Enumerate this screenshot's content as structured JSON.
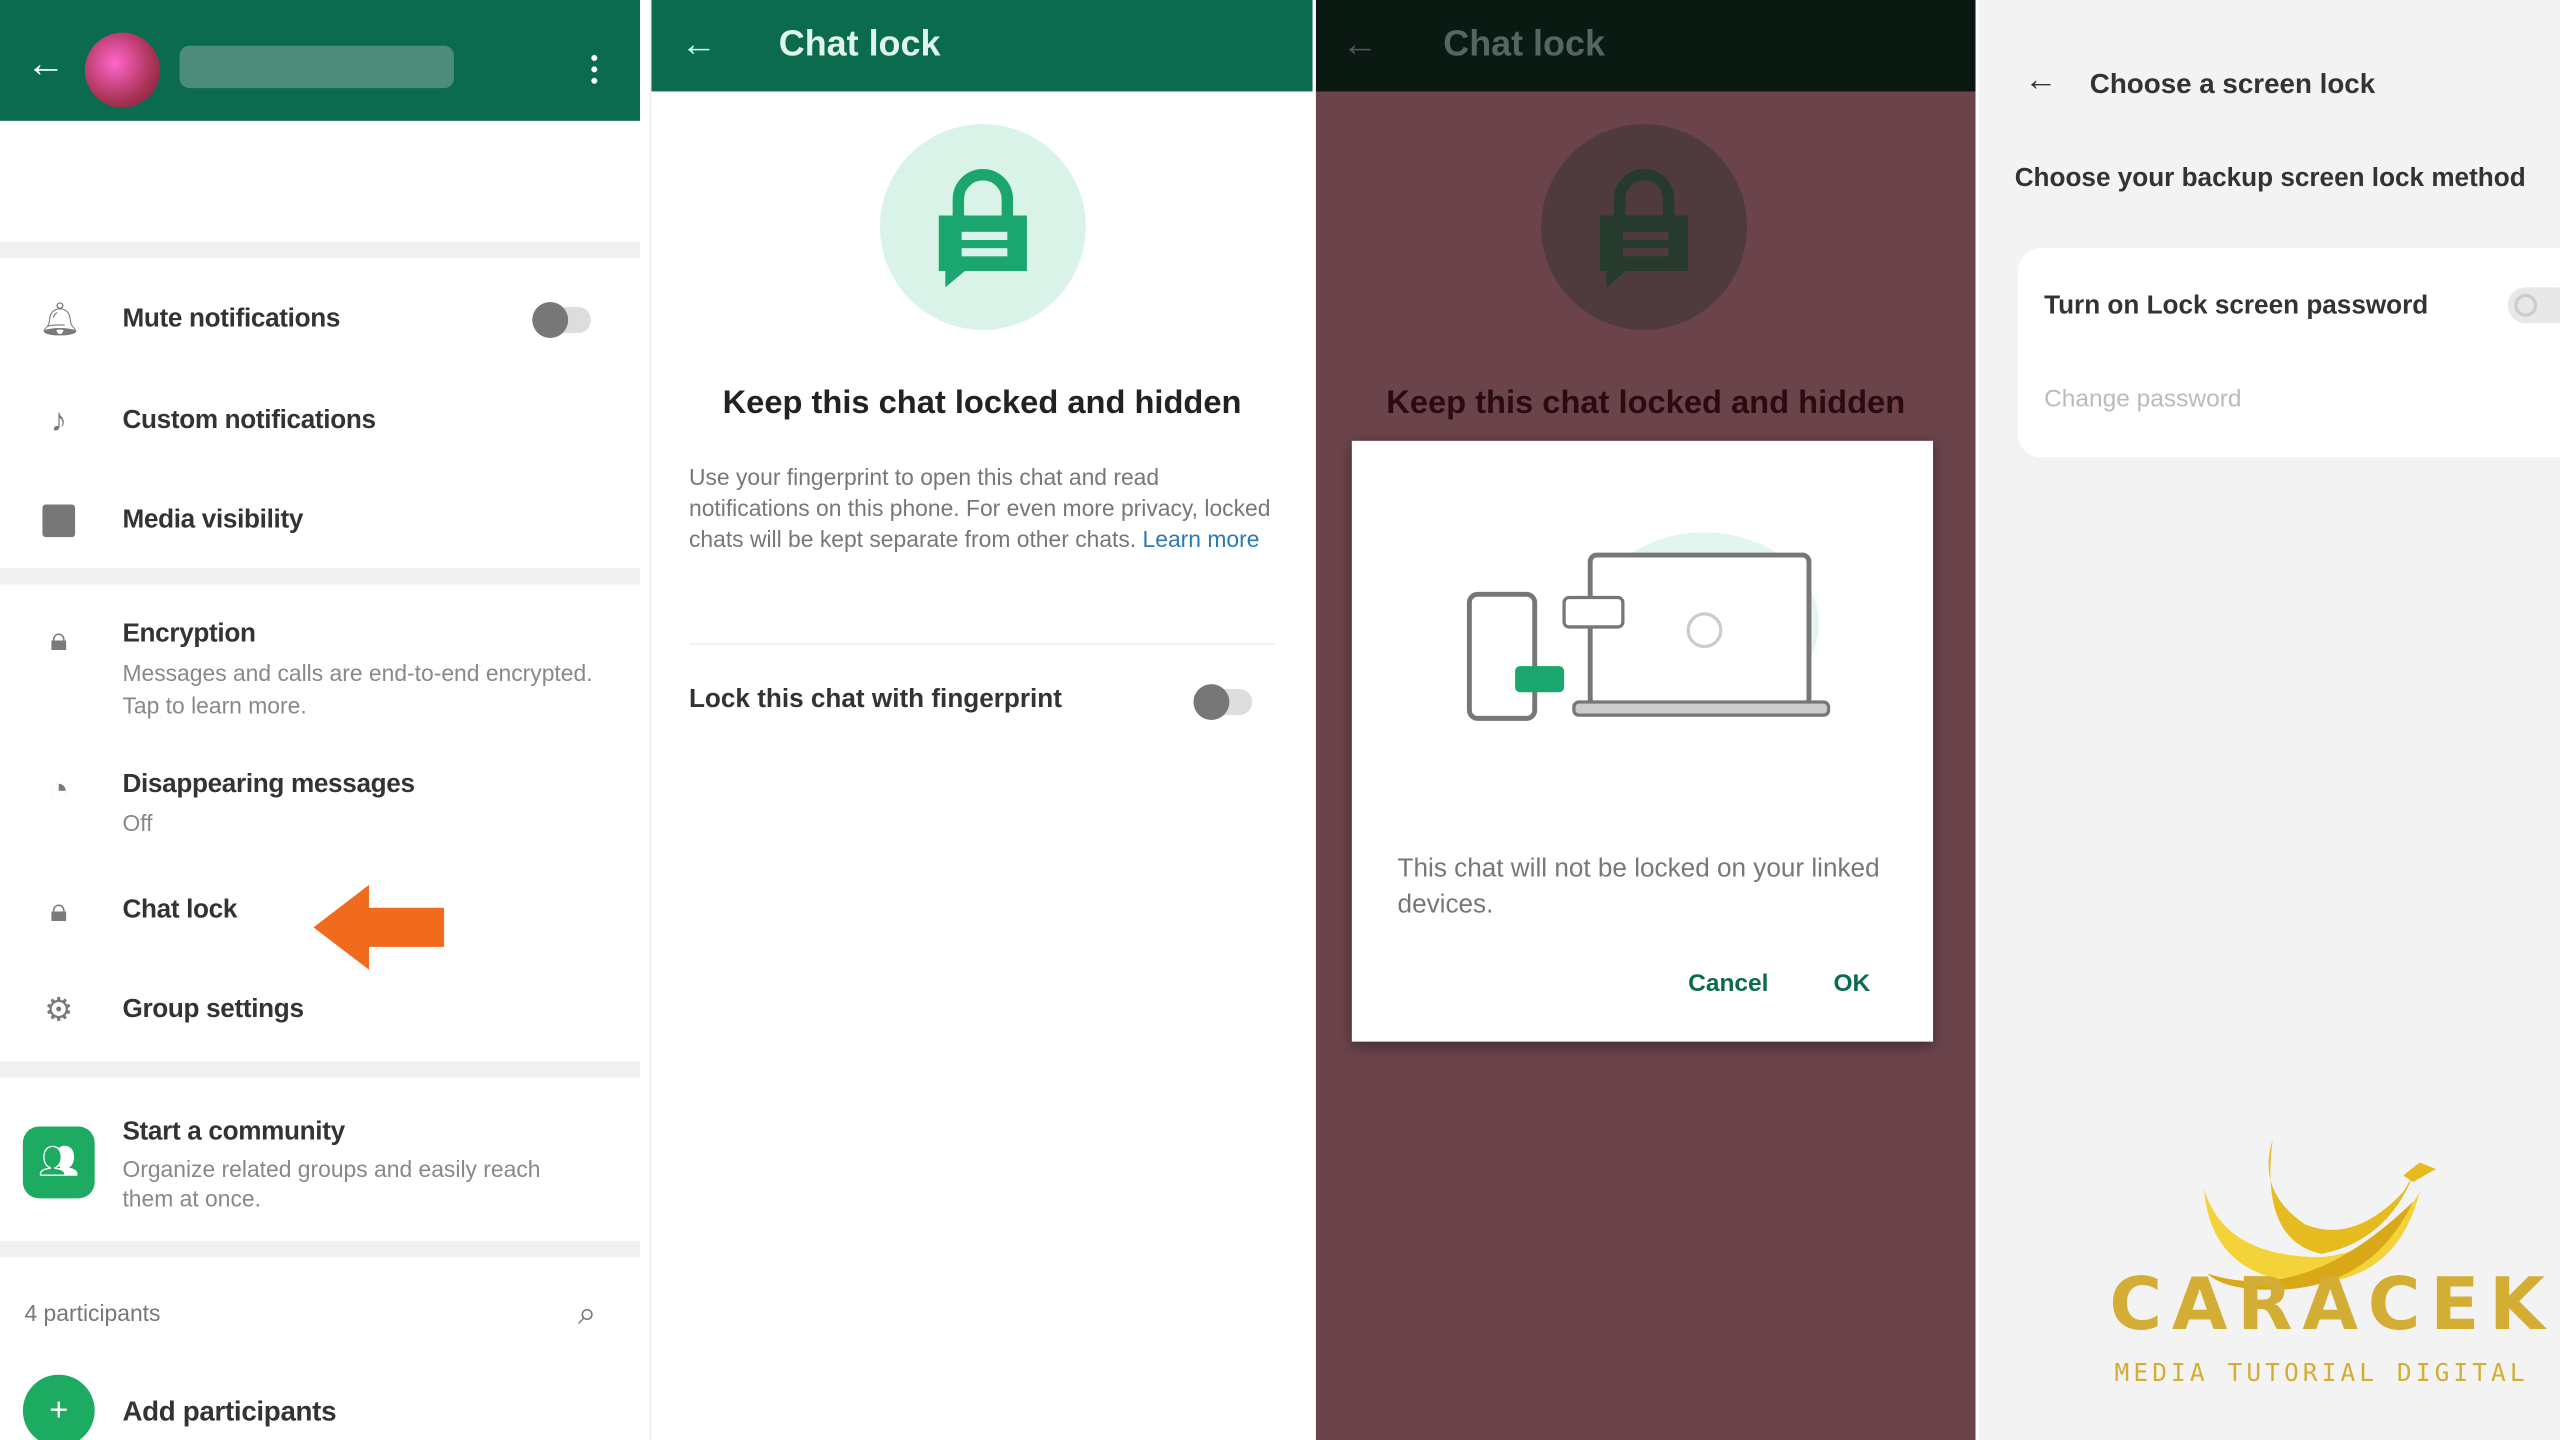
{
  "panel1": {
    "items": [
      {
        "label": "Mute notifications",
        "icon": "bell-icon"
      },
      {
        "label": "Custom notifications",
        "icon": "music-note-icon"
      },
      {
        "label": "Media visibility",
        "icon": "image-icon"
      },
      {
        "label": "Encryption",
        "sub": "Messages and calls are end-to-end encrypted. Tap to learn more.",
        "icon": "lock-icon"
      },
      {
        "label": "Disappearing messages",
        "sub": "Off",
        "icon": "timer-icon"
      },
      {
        "label": "Chat lock",
        "icon": "chat-lock-icon"
      },
      {
        "label": "Group settings",
        "icon": "gear-icon"
      },
      {
        "label": "Start a community",
        "sub": "Organize related groups and easily reach them at once.",
        "icon": "community-icon"
      }
    ],
    "participants_label": "4 participants",
    "add_participants": "Add participants",
    "mute_toggle_on": false,
    "accent": "#0b6b4f",
    "arrow_color": "#f26a1b"
  },
  "panel2": {
    "title": "Chat lock",
    "heading": "Keep this chat locked and hidden",
    "body": "Use your fingerprint to open this chat and read notifications on this phone. For even more privacy, locked chats will be kept separate from other chats.",
    "learn_more": "Learn more",
    "toggle_label": "Lock this chat with fingerprint",
    "toggle_on": false
  },
  "panel3": {
    "title": "Chat lock",
    "heading": "Keep this chat locked and hidden",
    "dialog_text": "This chat will not be locked on your linked devices.",
    "cancel": "Cancel",
    "ok": "OK"
  },
  "panel4": {
    "title": "Choose a screen lock",
    "subtitle": "Choose your backup screen lock method",
    "option": "Turn on Lock screen password",
    "option_on": false,
    "change_password": "Change password"
  },
  "watermark": {
    "name": "CARACEK",
    "tagline": "MEDIA TUTORIAL DIGITAL"
  }
}
